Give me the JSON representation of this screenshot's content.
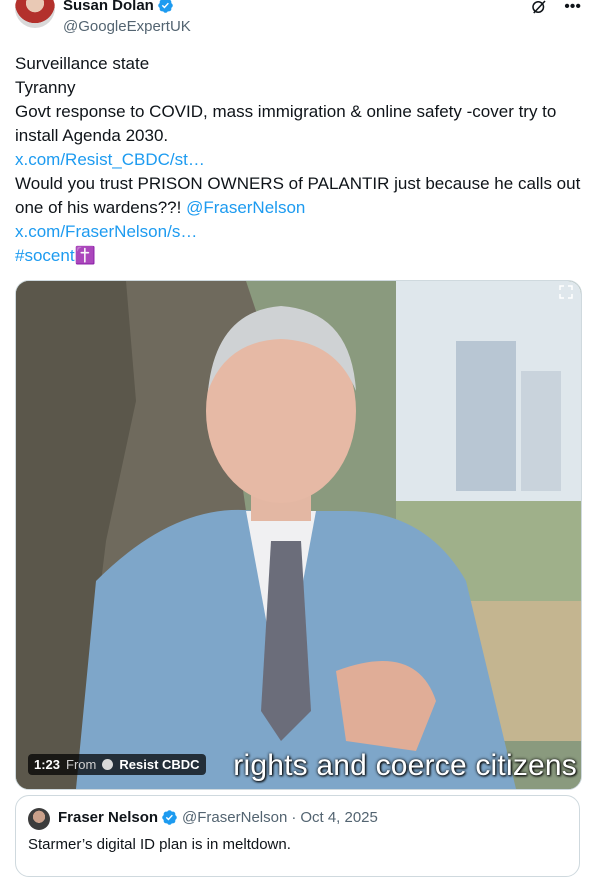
{
  "author": {
    "name": "Susan Dolan",
    "handle": "@GoogleExpertUK"
  },
  "tweet": {
    "lines": [
      {
        "text": "Surveillance state",
        "type": "text"
      },
      {
        "text": "Tyranny",
        "type": "text"
      },
      {
        "text": "Govt response to COVID, mass immigration & online safety -cover try to",
        "type": "text"
      },
      {
        "text": "install Agenda 2030.",
        "type": "text"
      }
    ],
    "link1": "x.com/Resist_CBDC/st…",
    "line5a": "Would you trust PRISON OWNERS of PALANTIR just because he calls out",
    "line5b": "one of his wardens??! ",
    "mention": "@FraserNelson",
    "link2": "x.com/FraserNelson/s…",
    "hashtag": "#socent",
    "hashtag_emoji": "✝️"
  },
  "media": {
    "caption": "rights and coerce citizens",
    "duration": "1:23",
    "from_label": "From",
    "source": "Resist CBDC"
  },
  "quote": {
    "name": "Fraser Nelson",
    "handle": "@FraserNelson",
    "separator": "·",
    "date": "Oct 4, 2025",
    "text": "Starmer’s digital ID plan is in meltdown."
  },
  "colors": {
    "link": "#1d9bf0",
    "verified": "#1d9bf0",
    "muted": "#536471"
  },
  "icons": [
    "verified-badge-icon",
    "grok-icon",
    "more-icon",
    "expand-icon"
  ]
}
